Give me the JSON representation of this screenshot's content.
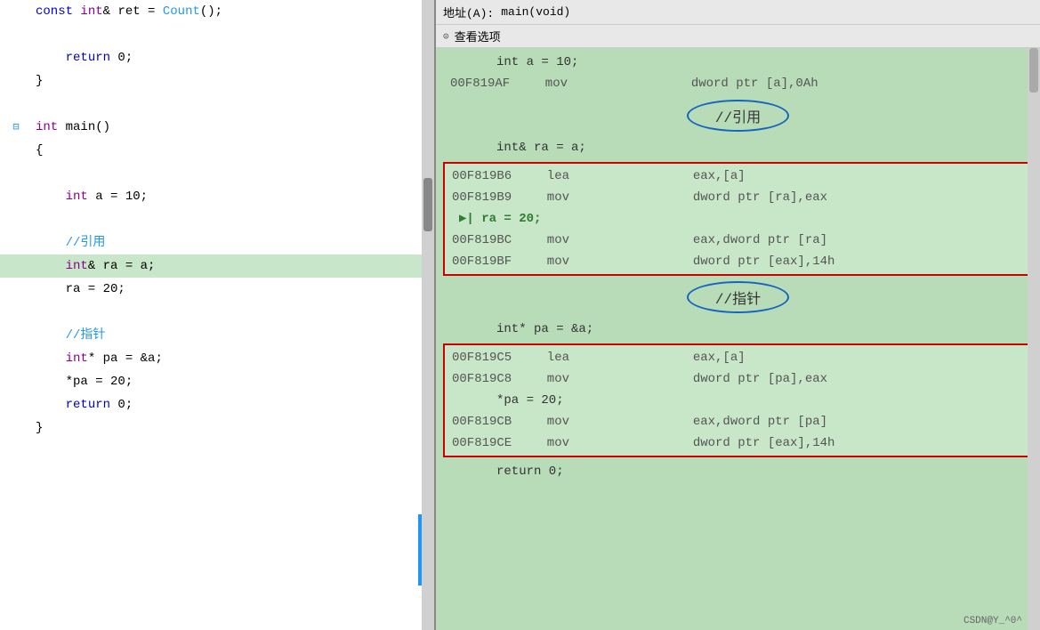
{
  "left_panel": {
    "lines": [
      {
        "id": 1,
        "gutter": "none",
        "indent": 2,
        "tokens": [
          {
            "text": "const ",
            "cls": "kw"
          },
          {
            "text": "int",
            "cls": "kw2"
          },
          {
            "text": "& ret = ",
            "cls": ""
          },
          {
            "text": "Count",
            "cls": "fn"
          },
          {
            "text": "();",
            "cls": ""
          }
        ]
      },
      {
        "id": 2,
        "gutter": "none",
        "indent": 0,
        "tokens": []
      },
      {
        "id": 3,
        "gutter": "none",
        "indent": 2,
        "tokens": [
          {
            "text": "return",
            "cls": "kw"
          },
          {
            "text": " 0;",
            "cls": ""
          }
        ]
      },
      {
        "id": 4,
        "gutter": "none",
        "indent": 0,
        "tokens": [
          {
            "text": "}",
            "cls": ""
          }
        ]
      },
      {
        "id": 5,
        "gutter": "none",
        "indent": 0,
        "tokens": []
      },
      {
        "id": 6,
        "gutter": "minus",
        "indent": 0,
        "tokens": [
          {
            "text": "int",
            "cls": "kw2"
          },
          {
            "text": " main()",
            "cls": ""
          }
        ]
      },
      {
        "id": 7,
        "gutter": "none",
        "indent": 0,
        "tokens": [
          {
            "text": "{",
            "cls": ""
          }
        ]
      },
      {
        "id": 8,
        "gutter": "none",
        "indent": 0,
        "tokens": []
      },
      {
        "id": 9,
        "gutter": "none",
        "indent": 2,
        "tokens": [
          {
            "text": "int",
            "cls": "kw2"
          },
          {
            "text": " a = 10;",
            "cls": ""
          }
        ]
      },
      {
        "id": 10,
        "gutter": "none",
        "indent": 0,
        "tokens": []
      },
      {
        "id": 11,
        "gutter": "none",
        "indent": 2,
        "tokens": [
          {
            "text": "//引用",
            "cls": "comment"
          }
        ],
        "highlighted": false
      },
      {
        "id": 12,
        "gutter": "none",
        "indent": 2,
        "tokens": [
          {
            "text": "int",
            "cls": "kw2"
          },
          {
            "text": "& ra = a;",
            "cls": ""
          }
        ],
        "highlighted": true
      },
      {
        "id": 13,
        "gutter": "none",
        "indent": 2,
        "tokens": [
          {
            "text": "ra = 20;",
            "cls": ""
          }
        ]
      },
      {
        "id": 14,
        "gutter": "none",
        "indent": 0,
        "tokens": []
      },
      {
        "id": 15,
        "gutter": "none",
        "indent": 2,
        "tokens": [
          {
            "text": "//指针",
            "cls": "comment"
          }
        ]
      },
      {
        "id": 16,
        "gutter": "none",
        "indent": 2,
        "tokens": [
          {
            "text": "int",
            "cls": "kw2"
          },
          {
            "text": "* pa = &a;",
            "cls": ""
          }
        ]
      },
      {
        "id": 17,
        "gutter": "none",
        "indent": 2,
        "tokens": [
          {
            "text": "*pa = 20;",
            "cls": ""
          }
        ]
      },
      {
        "id": 18,
        "gutter": "none",
        "indent": 2,
        "tokens": [
          {
            "text": "return",
            "cls": "kw"
          },
          {
            "text": " 0;",
            "cls": ""
          }
        ]
      },
      {
        "id": 19,
        "gutter": "none",
        "indent": 0,
        "tokens": [
          {
            "text": "}",
            "cls": ""
          }
        ]
      }
    ]
  },
  "right_panel": {
    "addr_label": "地址(A):",
    "addr_value": "main(void)",
    "view_options": "查看选项",
    "sections": [
      {
        "type": "src",
        "text": "    int a = 10;"
      },
      {
        "type": "asm",
        "addr": "00F819AF",
        "instr": "mov",
        "ops": "        dword ptr [a],0Ah"
      },
      {
        "type": "oval",
        "text": "//引用"
      },
      {
        "type": "src",
        "text": "    int& ra = a;"
      },
      {
        "type": "redbox_start"
      },
      {
        "type": "asm",
        "addr": "00F819B6",
        "instr": "lea",
        "ops": "        eax,[a]"
      },
      {
        "type": "asm",
        "addr": "00F819B9",
        "instr": "mov",
        "ops": "        dword ptr [ra],eax"
      },
      {
        "type": "asm_arrow",
        "addr": "",
        "instr": "",
        "ops": "▶| ra = 20;"
      },
      {
        "type": "asm",
        "addr": "00F819BC",
        "instr": "mov",
        "ops": "        eax,dword ptr [ra]"
      },
      {
        "type": "asm",
        "addr": "00F819BF",
        "instr": "mov",
        "ops": "        dword ptr [eax],14h"
      },
      {
        "type": "redbox_end"
      },
      {
        "type": "oval",
        "text": "//指针"
      },
      {
        "type": "src",
        "text": "    int* pa = &a;"
      },
      {
        "type": "redbox2_start"
      },
      {
        "type": "asm",
        "addr": "00F819C5",
        "instr": "lea",
        "ops": "        eax,[a]"
      },
      {
        "type": "asm",
        "addr": "00F819C8",
        "instr": "mov",
        "ops": "        dword ptr [pa],eax"
      },
      {
        "type": "src2",
        "text": "        *pa = 20;"
      },
      {
        "type": "asm",
        "addr": "00F819CB",
        "instr": "mov",
        "ops": "        eax,dword ptr [pa]"
      },
      {
        "type": "asm",
        "addr": "00F819CE",
        "instr": "mov",
        "ops": "        dword ptr [eax],14h"
      },
      {
        "type": "redbox2_end"
      },
      {
        "type": "src",
        "text": "    return 0;"
      }
    ],
    "watermark": "CSDN@Y_^0^"
  }
}
